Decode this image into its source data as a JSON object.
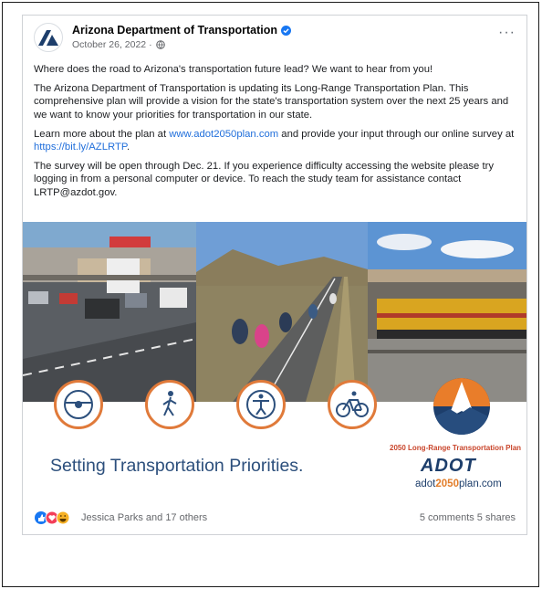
{
  "post": {
    "page_name": "Arizona Department of Transportation",
    "date": "October 26, 2022",
    "date_separator": "·",
    "more_label": "···",
    "body": {
      "line1": "Where does the road to Arizona's transportation future lead? We want to hear from you!",
      "line2": "The Arizona Department of Transportation is updating its Long-Range Transportation Plan. This comprehensive plan will provide a vision for the state's transportation system over the next 25 years and we want to know your priorities for transportation in our state.",
      "line3_prefix": "Learn more about the plan at ",
      "line3_link": "www.adot2050plan.com",
      "line3_mid": " and provide your input through our online survey at ",
      "line3_link2": "https://bit.ly/AZLRTP",
      "line3_suffix": ".",
      "line4": "The survey will be open through Dec. 21. If you experience difficulty accessing the website please try logging in from a personal computer or device. To reach the study team for assistance contact LRTP@azdot.gov."
    }
  },
  "graphic": {
    "headline": "Setting Transportation Priorities.",
    "plan_label": "2050 Long-Range Transportation Plan",
    "brand": "ADOT",
    "url_prefix": "adot",
    "url_accent": "2050",
    "url_suffix": "plan.com",
    "icons": [
      "steering-wheel-icon",
      "pedestrian-icon",
      "accessibility-icon",
      "bicycle-icon"
    ],
    "accent_color": "#e07a3a"
  },
  "footer": {
    "reactors": "Jessica Parks and 17 others",
    "counts": "5 comments 5 shares",
    "reaction_icons": [
      "like-icon",
      "love-icon",
      "haha-icon"
    ]
  },
  "colors": {
    "link": "#216fdb",
    "verified": "#1877f2",
    "headline": "#2c4f7c"
  }
}
